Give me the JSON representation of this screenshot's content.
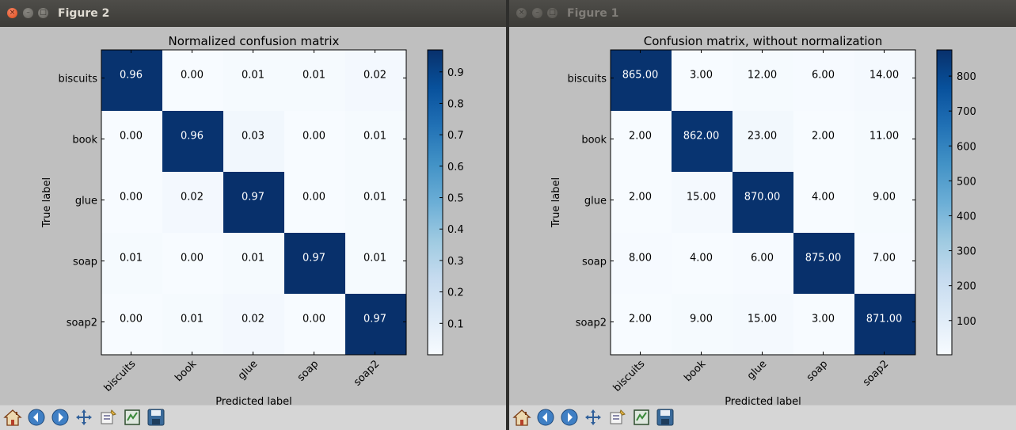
{
  "windows": [
    {
      "title": "Figure 2",
      "active": true,
      "chart_data": {
        "type": "heatmap",
        "title": "Normalized confusion matrix",
        "xlabel": "Predicted label",
        "ylabel": "True label",
        "x_categories": [
          "biscuits",
          "book",
          "glue",
          "soap",
          "soap2"
        ],
        "y_categories": [
          "biscuits",
          "book",
          "glue",
          "soap",
          "soap2"
        ],
        "values": [
          [
            0.96,
            0.0,
            0.01,
            0.01,
            0.02
          ],
          [
            0.0,
            0.96,
            0.03,
            0.0,
            0.01
          ],
          [
            0.0,
            0.02,
            0.97,
            0.0,
            0.01
          ],
          [
            0.01,
            0.0,
            0.01,
            0.97,
            0.01
          ],
          [
            0.0,
            0.01,
            0.02,
            0.0,
            0.97
          ]
        ],
        "cell_labels": [
          [
            "0.96",
            "0.00",
            "0.01",
            "0.01",
            "0.02"
          ],
          [
            "0.00",
            "0.96",
            "0.03",
            "0.00",
            "0.01"
          ],
          [
            "0.00",
            "0.02",
            "0.97",
            "0.00",
            "0.01"
          ],
          [
            "0.01",
            "0.00",
            "0.01",
            "0.97",
            "0.01"
          ],
          [
            "0.00",
            "0.01",
            "0.02",
            "0.00",
            "0.97"
          ]
        ],
        "colormap": "Blues",
        "vmin": 0.0,
        "vmax": 0.97,
        "colorbar_ticks": [
          0.1,
          0.2,
          0.3,
          0.4,
          0.5,
          0.6,
          0.7,
          0.8,
          0.9
        ],
        "colorbar_tick_labels": [
          "0.1",
          "0.2",
          "0.3",
          "0.4",
          "0.5",
          "0.6",
          "0.7",
          "0.8",
          "0.9"
        ]
      }
    },
    {
      "title": "Figure 1",
      "active": false,
      "chart_data": {
        "type": "heatmap",
        "title": "Confusion matrix, without normalization",
        "xlabel": "Predicted label",
        "ylabel": "True label",
        "x_categories": [
          "biscuits",
          "book",
          "glue",
          "soap",
          "soap2"
        ],
        "y_categories": [
          "biscuits",
          "book",
          "glue",
          "soap",
          "soap2"
        ],
        "values": [
          [
            865,
            3,
            12,
            6,
            14
          ],
          [
            2,
            862,
            23,
            2,
            11
          ],
          [
            2,
            15,
            870,
            4,
            9
          ],
          [
            8,
            4,
            6,
            875,
            7
          ],
          [
            2,
            9,
            15,
            3,
            871
          ]
        ],
        "cell_labels": [
          [
            "865.00",
            "3.00",
            "12.00",
            "6.00",
            "14.00"
          ],
          [
            "2.00",
            "862.00",
            "23.00",
            "2.00",
            "11.00"
          ],
          [
            "2.00",
            "15.00",
            "870.00",
            "4.00",
            "9.00"
          ],
          [
            "8.00",
            "4.00",
            "6.00",
            "875.00",
            "7.00"
          ],
          [
            "2.00",
            "9.00",
            "15.00",
            "3.00",
            "871.00"
          ]
        ],
        "colormap": "Blues",
        "vmin": 2,
        "vmax": 875,
        "colorbar_ticks": [
          100,
          200,
          300,
          400,
          500,
          600,
          700,
          800
        ],
        "colorbar_tick_labels": [
          "100",
          "200",
          "300",
          "400",
          "500",
          "600",
          "700",
          "800"
        ]
      }
    }
  ],
  "toolbar": {
    "buttons": [
      {
        "name": "home-icon",
        "tooltip": ""
      },
      {
        "name": "back-icon",
        "tooltip": ""
      },
      {
        "name": "forward-icon",
        "tooltip": ""
      },
      {
        "name": "pan-icon",
        "tooltip": ""
      },
      {
        "name": "zoom-icon",
        "tooltip": ""
      },
      {
        "name": "configure-subplots-icon",
        "tooltip": ""
      },
      {
        "name": "save-icon",
        "tooltip": ""
      }
    ]
  },
  "colors": {
    "titlebar": "#3c3b37",
    "close_button": "#df4a16",
    "figure_background": "#bfbfbf",
    "toolbar_background": "#d6d6d6",
    "cmap_low": "#f7fbff",
    "cmap_high": "#08306b"
  }
}
